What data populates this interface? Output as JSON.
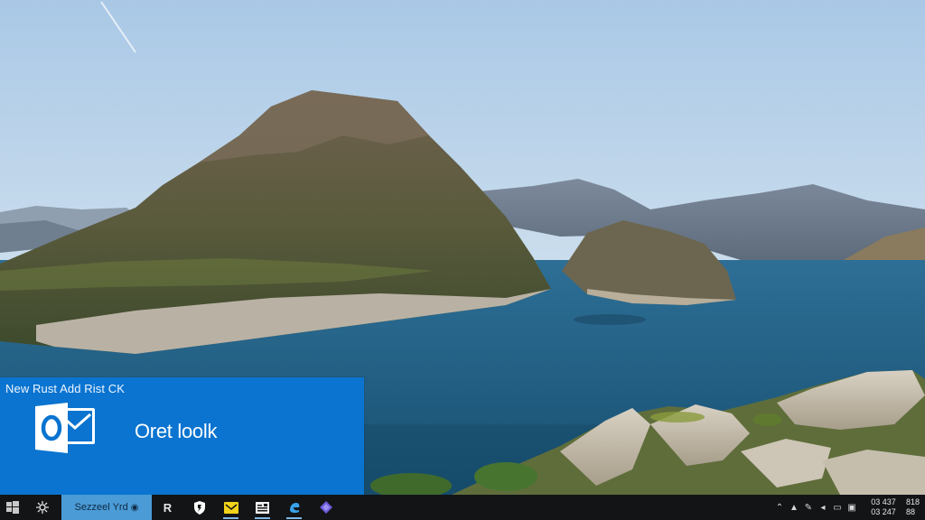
{
  "notification": {
    "header": "New Rust Add Rist CK",
    "title": "Oret loolk",
    "app_icon": "outlook-icon",
    "accent": "#0a74d0"
  },
  "taskbar": {
    "search_label": "Sezzeel Yrd",
    "apps": [
      {
        "name": "start-icon"
      },
      {
        "name": "task-view-icon"
      },
      {
        "name": "search-letter-icon"
      },
      {
        "name": "shield-app-icon"
      },
      {
        "name": "mail-app-icon"
      },
      {
        "name": "document-app-icon"
      },
      {
        "name": "edge-app-icon"
      },
      {
        "name": "diamond-app-icon"
      }
    ],
    "clock": {
      "time": "03 437",
      "date": "03 247",
      "tail_top": "818",
      "tail_bottom": "88"
    }
  },
  "colors": {
    "taskbar": "#121416",
    "search_box": "#4a9bd6",
    "sky": "#b9d3ea",
    "water": "#1e5a80"
  }
}
